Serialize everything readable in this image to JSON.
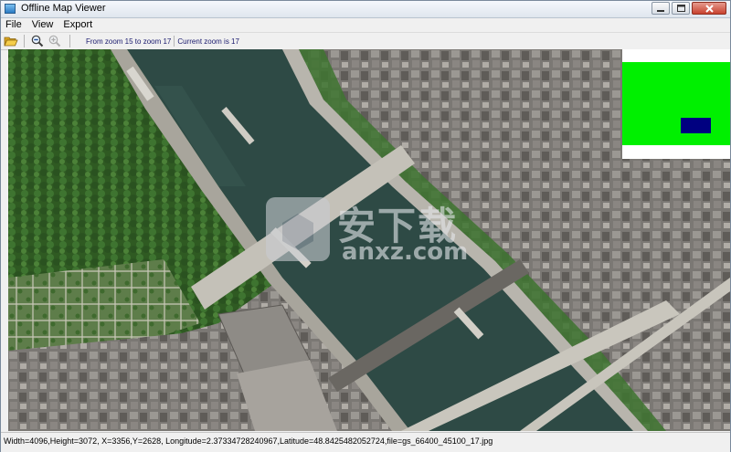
{
  "window": {
    "title": "Offline Map Viewer"
  },
  "menu": {
    "file": "File",
    "view": "View",
    "export": "Export"
  },
  "toolbar": {
    "zoom_range_text": "From zoom 15 to zoom 17",
    "current_zoom_text": "Current zoom is 17"
  },
  "statusbar": {
    "text": "Width=4096,Height=3072, X=3356,Y=2628, Longitude=2.37334728240967,Latitude=48.8425482052724,file=gs_66400_45100_17.jpg"
  },
  "watermark": {
    "text": "安下载",
    "subtext": "anxz.com"
  },
  "colors": {
    "overview_bg": "#00f000",
    "overview_viewport": "#000080",
    "river": "#2e4a45",
    "vegetation": "#3c6b2b"
  },
  "icons": {
    "open": "folder-open-icon",
    "zoom_out": "zoom-out-icon",
    "zoom_in": "zoom-in-icon"
  }
}
